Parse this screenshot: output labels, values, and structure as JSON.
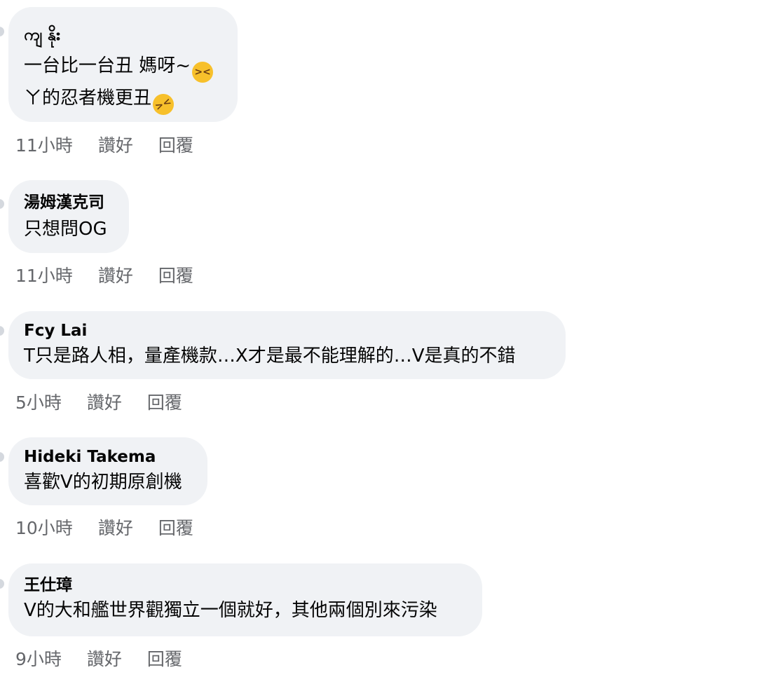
{
  "comments": [
    {
      "author": "ကျ နိုး",
      "lines": [
        "一台比一台丑 媽呀~",
        "ㄚ的忍者機更丑"
      ],
      "emojis": [
        "grinning-squinting-face",
        "rolling-on-floor-laughing"
      ],
      "time": "11小時",
      "like": "讚好",
      "reply": "回覆"
    },
    {
      "author": "湯姆漢克司",
      "lines": [
        "只想問OG"
      ],
      "time": "11小時",
      "like": "讚好",
      "reply": "回覆"
    },
    {
      "author": "Fcy Lai",
      "lines": [
        "T只是路人相，量產機款…X才是最不能理解的…V是真的不錯"
      ],
      "time": "5小時",
      "like": "讚好",
      "reply": "回覆"
    },
    {
      "author": "Hideki Takema",
      "lines": [
        "喜歡V的初期原創機"
      ],
      "time": "10小時",
      "like": "讚好",
      "reply": "回覆"
    },
    {
      "author": "王仕璋",
      "lines": [
        "V的大和艦世界觀獨立一個就好，其他兩個別來污染"
      ],
      "time": "9小時",
      "like": "讚好",
      "reply": "回覆"
    }
  ],
  "colors": {
    "bubble": "#f0f2f5",
    "meta_text": "#65676b",
    "body_text": "#050505"
  }
}
